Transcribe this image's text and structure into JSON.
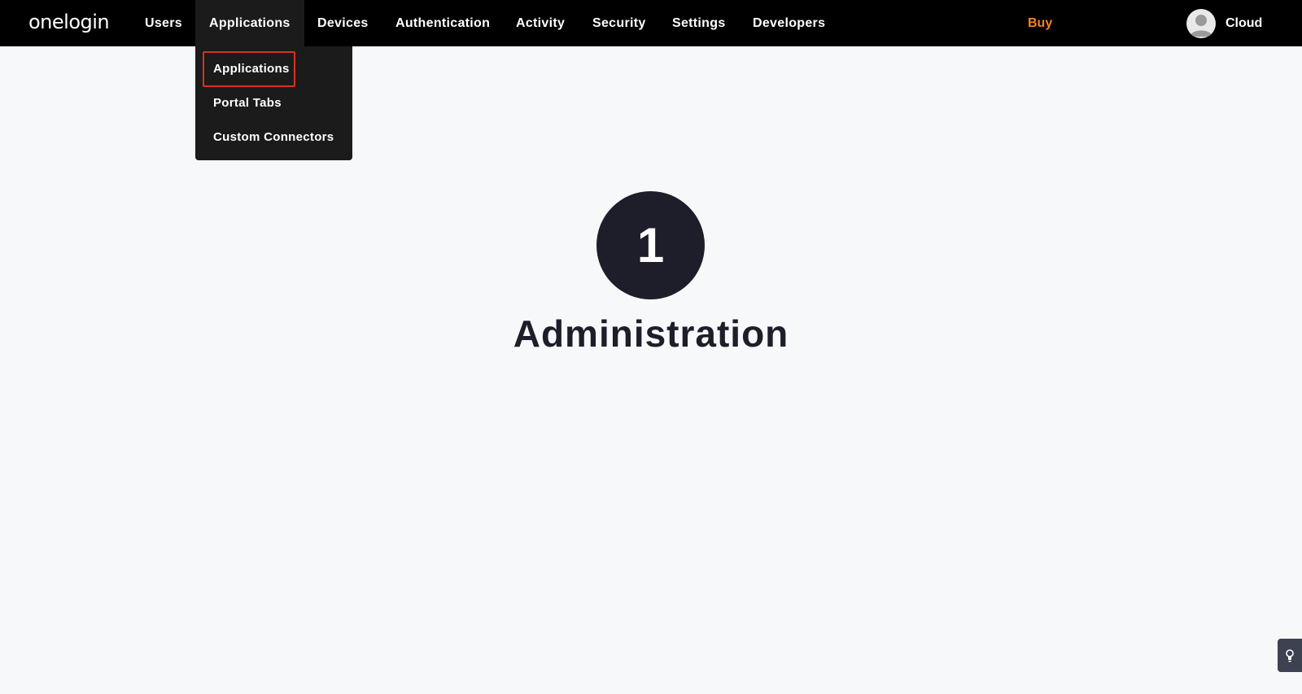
{
  "app": {
    "logo_text": "onelogin"
  },
  "nav": {
    "items": [
      {
        "label": "Users"
      },
      {
        "label": "Applications"
      },
      {
        "label": "Devices"
      },
      {
        "label": "Authentication"
      },
      {
        "label": "Activity"
      },
      {
        "label": "Security"
      },
      {
        "label": "Settings"
      },
      {
        "label": "Developers"
      }
    ],
    "active_item": "Applications",
    "buy_label": "Buy",
    "buy_color": "#f5821f",
    "user_name": "Cloud",
    "avatar_icon": "user-avatar-icon"
  },
  "dropdown": {
    "items": [
      {
        "label": "Applications"
      },
      {
        "label": "Portal Tabs"
      },
      {
        "label": "Custom Connectors"
      }
    ],
    "highlighted_item": "Applications",
    "highlight_color": "#d9321f"
  },
  "main": {
    "step_number": "1",
    "title": "Administration"
  },
  "help_widget": {
    "icon": "lightbulb-icon"
  },
  "colors": {
    "topbar_bg": "#000000",
    "dropdown_bg": "#1b1b1b",
    "page_bg": "#f7f8fa",
    "circle_bg": "#1d1e29"
  }
}
